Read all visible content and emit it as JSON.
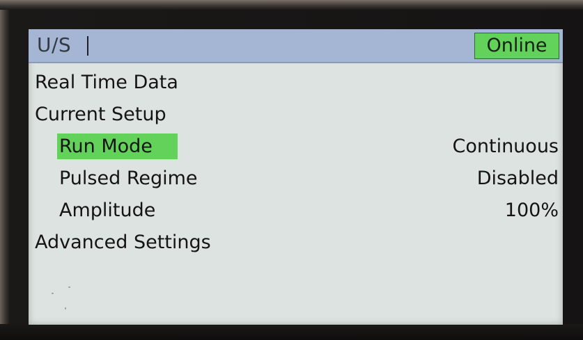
{
  "title_bar": {
    "title": "U/S",
    "status": "Online"
  },
  "menu": {
    "real_time_data": "Real Time Data",
    "current_setup": "Current Setup",
    "run_mode": {
      "label": "Run Mode",
      "value": "Continuous"
    },
    "pulsed_regime": {
      "label": "Pulsed Regime",
      "value": "Disabled"
    },
    "amplitude": {
      "label": "Amplitude",
      "value": "100%"
    },
    "advanced_settings": "Advanced Settings"
  },
  "colors": {
    "title_bar_bg": "#a4b6d3",
    "selection_green": "#63d25a",
    "screen_bg": "#dde3e1"
  }
}
